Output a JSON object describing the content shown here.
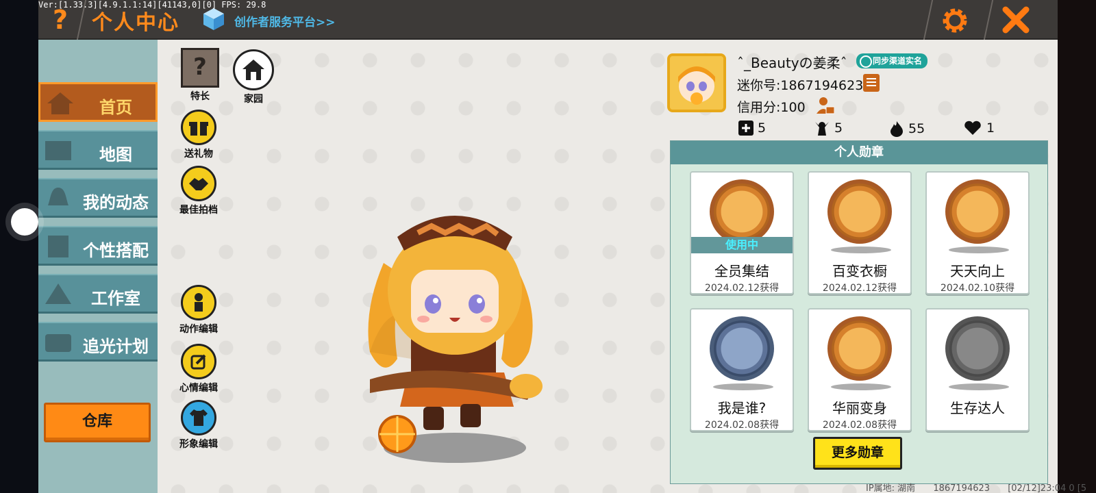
{
  "debug_text": "Ver:[1.33.3][4.9.1.1:14][41143,0][0] FPS: 29.8",
  "topbar": {
    "help_label": "?",
    "title": "个人中心",
    "creator_link": "创作者服务平台>>"
  },
  "sidebar": {
    "items": [
      {
        "label": "首页",
        "active": true
      },
      {
        "label": "地图",
        "active": false
      },
      {
        "label": "我的动态",
        "active": false
      },
      {
        "label": "个性搭配",
        "active": false
      },
      {
        "label": "工作室",
        "active": false
      },
      {
        "label": "追光计划",
        "active": false
      }
    ],
    "warehouse_label": "仓库"
  },
  "tools": {
    "specialty": {
      "label": "特长",
      "glyph": "?"
    },
    "home": {
      "label": "家园"
    },
    "gift": {
      "label": "送礼物"
    },
    "partner": {
      "label": "最佳拍档"
    },
    "action_edit": {
      "label": "动作编辑"
    },
    "mood_edit": {
      "label": "心情编辑"
    },
    "image_edit": {
      "label": "形象编辑"
    }
  },
  "profile": {
    "name": "ˆ_Beautyの姜柔ˆ",
    "realname_badge": "同步渠道实名",
    "mini_id": "迷你号:1867194623",
    "credit": "信用分:100",
    "stats": {
      "add": "5",
      "fans": "5",
      "fire": "55",
      "like": "1"
    }
  },
  "medals": {
    "title": "个人勋章",
    "in_use_label": "使用中",
    "items": [
      {
        "name": "全员集结",
        "date": "2024.02.12获得",
        "style": "bronze",
        "in_use": true
      },
      {
        "name": "百变衣橱",
        "date": "2024.02.12获得",
        "style": "bronze",
        "in_use": false
      },
      {
        "name": "天天向上",
        "date": "2024.02.10获得",
        "style": "bronze",
        "in_use": false
      },
      {
        "name": "我是谁?",
        "date": "2024.02.08获得",
        "style": "blue",
        "in_use": false
      },
      {
        "name": "华丽变身",
        "date": "2024.02.08获得",
        "style": "bronze",
        "in_use": false
      },
      {
        "name": "生存达人",
        "date": "",
        "style": "gray",
        "in_use": false
      }
    ],
    "more_button": "更多勋章"
  },
  "footer": {
    "ip": "IP属地: 湖南",
    "uid": "1867194623",
    "time": "[02/12]23:04 0 [5"
  },
  "colors": {
    "accent_orange": "#ff8a1c",
    "sidebar_teal": "#58919a",
    "medal_head": "#5a9598",
    "button_yellow": "#ffe21a"
  }
}
